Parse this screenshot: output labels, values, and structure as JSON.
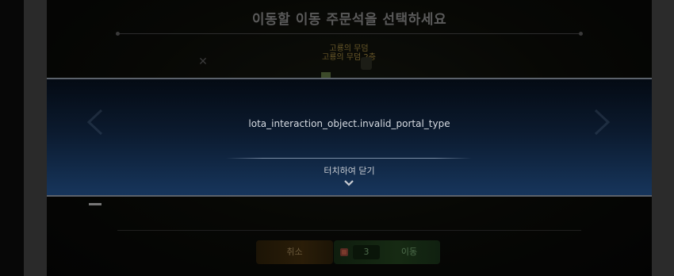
{
  "header": {
    "title": "이동할 이동 주문석을 선택하세요"
  },
  "portal": {
    "line1": "고룡의 무덤",
    "line2": "고룡의 무덤 2층"
  },
  "popup": {
    "message": "lota_interaction_object.invalid_portal_type",
    "close_hint": "터치하여 닫기"
  },
  "footer": {
    "cancel_label": "취소",
    "move_count": "3",
    "move_label": "이동"
  },
  "colors": {
    "popup_top": "#040a13",
    "popup_bottom": "#17365d",
    "cancel_bg": "#2a1d08",
    "move_bg": "#162a13"
  }
}
